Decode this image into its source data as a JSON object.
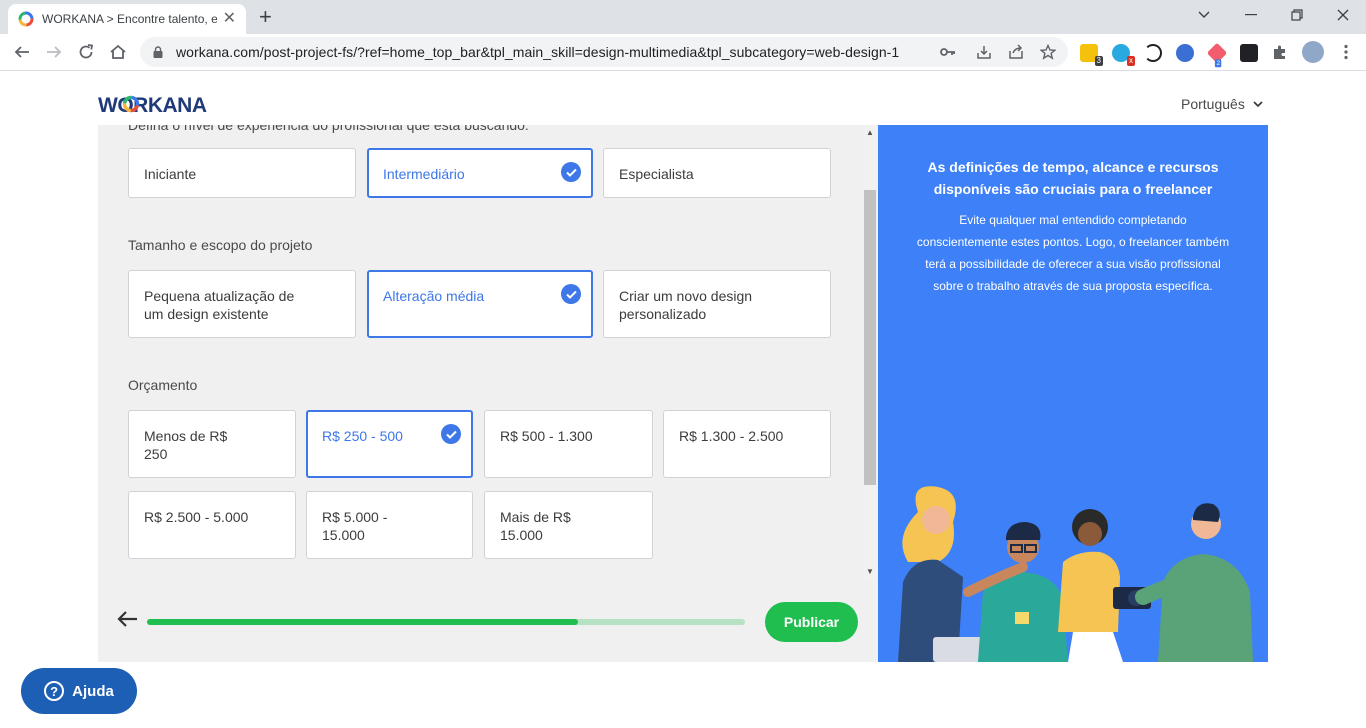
{
  "browser": {
    "tab_title": "WORKANA > Encontre talento, e",
    "url": "workana.com/post-project-fs/?ref=home_top_bar&tpl_main_skill=design-multimedia&tpl_subcategory=web-design-1",
    "ext_badges": [
      "3",
      "2"
    ]
  },
  "header": {
    "logo": "WORKANA",
    "language": "Português"
  },
  "form": {
    "cutoff_label": "Defina o nível de experiência do profissional que está buscando:",
    "experience": [
      "Iniciante",
      "Intermediário",
      "Especialista"
    ],
    "size_label": "Tamanho e escopo do projeto",
    "size": [
      "Pequena atualização de um design existente",
      "Alteração média",
      "Criar um novo design personalizado"
    ],
    "budget_label": "Orçamento",
    "budget": [
      "Menos de R$ 250",
      "R$ 250 - 500",
      "R$ 500 - 1.300",
      "R$ 1.300 - 2.500",
      "R$ 2.500 - 5.000",
      "R$ 5.000 - 15.000",
      "Mais de R$ 15.000"
    ],
    "progress": 0.72,
    "publish": "Publicar"
  },
  "side": {
    "title": "As definições de tempo, alcance e recursos disponíveis são cruciais para o freelancer",
    "body": "Evite qualquer mal entendido completando conscientemente estes pontos. Logo, o freelancer também terá a possibilidade de oferecer a sua visão profissional sobre o trabalho através de sua proposta específica."
  },
  "help": {
    "label": "Ajuda"
  },
  "colors": {
    "accent": "#3d77e8",
    "green": "#20be4e",
    "side": "#3d80f8",
    "help": "#1d5fb4"
  }
}
